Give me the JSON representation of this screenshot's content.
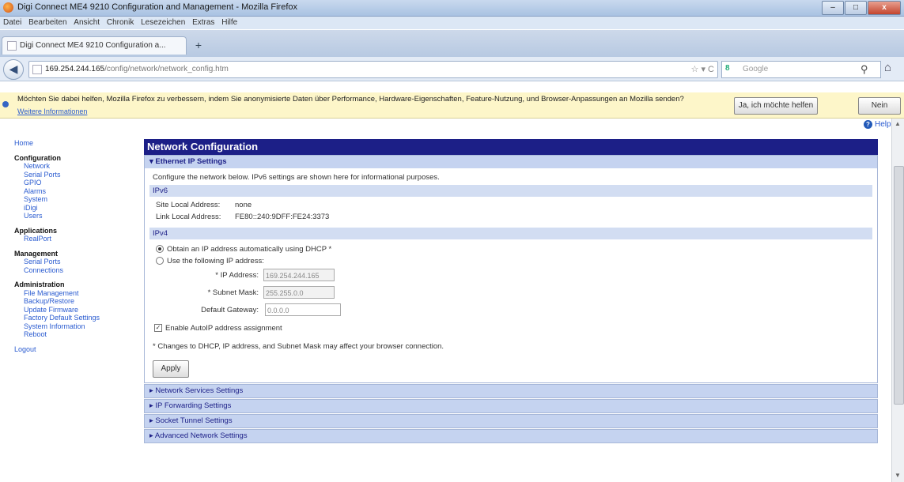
{
  "window": {
    "title": "Digi Connect ME4 9210 Configuration and Management - Mozilla Firefox",
    "minimize": "–",
    "maximize": "□",
    "close": "x"
  },
  "menu": [
    "Datei",
    "Bearbeiten",
    "Ansicht",
    "Chronik",
    "Lesezeichen",
    "Extras",
    "Hilfe"
  ],
  "tab": {
    "label": "Digi Connect ME4 9210 Configuration a...",
    "new_tab": "+"
  },
  "nav": {
    "back": "◀",
    "url_host": "169.254.244.165",
    "url_path": "/config/network/network_config.htm",
    "url_controls": "☆ ▾ C",
    "search_engine": "8",
    "search_placeholder": "Google",
    "search_icon": "⚲",
    "home_icon": "⌂"
  },
  "notification": {
    "message": "Möchten Sie dabei helfen, Mozilla Firefox zu verbessern, indem Sie anonymisierte Daten über Performance, Hardware-Eigenschaften, Feature-Nutzung, und Browser-Anpassungen an Mozilla senden?",
    "more_link": "Weitere Informationen",
    "yes_button": "Ja, ich möchte helfen",
    "no_button": "Nein"
  },
  "help": {
    "label": "Help",
    "icon": "?"
  },
  "sidebar": {
    "home": "Home",
    "groups": [
      {
        "heading": "Configuration",
        "items": [
          "Network",
          "Serial Ports",
          "GPIO",
          "Alarms",
          "System",
          "iDigi",
          "Users"
        ]
      },
      {
        "heading": "Applications",
        "items": [
          "RealPort"
        ]
      },
      {
        "heading": "Management",
        "items": [
          "Serial Ports",
          "Connections"
        ]
      },
      {
        "heading": "Administration",
        "items": [
          "File Management",
          "Backup/Restore",
          "Update Firmware",
          "Factory Default Settings",
          "System Information",
          "Reboot"
        ]
      }
    ],
    "logout": "Logout"
  },
  "main": {
    "title": "Network Configuration",
    "ethernet_section": "▾ Ethernet IP Settings",
    "intro": "Configure the network below. IPv6 settings are shown here for informational purposes.",
    "ipv6_heading": "IPv6",
    "site_local_label": "Site Local Address:",
    "site_local_value": "none",
    "link_local_label": "Link Local Address:",
    "link_local_value": "FE80::240:9DFF:FE24:3373",
    "ipv4_heading": "IPv4",
    "dhcp_option": "Obtain an IP address automatically using DHCP *",
    "static_option": "Use the following IP address:",
    "ip_label": "* IP Address:",
    "ip_value": "169.254.244.165",
    "mask_label": "* Subnet Mask:",
    "mask_value": "255.255.0.0",
    "gateway_label": "Default Gateway:",
    "gateway_value": "0.0.0.0",
    "autoip_label": "Enable AutoIP address assignment",
    "note": "* Changes to DHCP, IP address, and Subnet Mask may affect your browser connection.",
    "apply": "Apply",
    "collapsed": [
      "▸ Network Services Settings",
      "▸ IP Forwarding Settings",
      "▸ Socket Tunnel Settings",
      "▸ Advanced Network Settings"
    ]
  }
}
